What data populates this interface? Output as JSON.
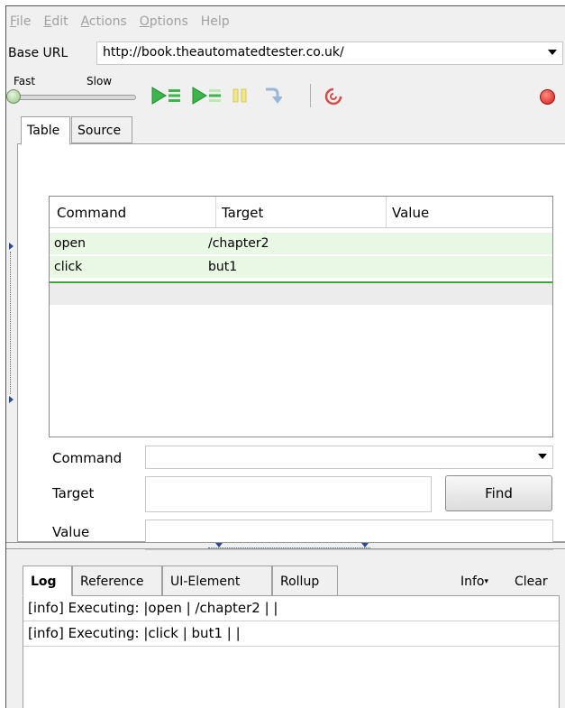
{
  "menu": {
    "items": [
      {
        "label": "File",
        "accel": "F",
        "rest": "ile"
      },
      {
        "label": "Edit",
        "accel": "E",
        "rest": "dit"
      },
      {
        "label": "Actions",
        "accel": "A",
        "rest": "ctions"
      },
      {
        "label": "Options",
        "accel": "O",
        "rest": "ptions"
      },
      {
        "label": "Help",
        "accel": "",
        "rest": "Help"
      }
    ]
  },
  "base_url": {
    "label": "Base URL",
    "value": "http://book.theautomatedtester.co.uk/"
  },
  "toolbar": {
    "speed_fast": "Fast",
    "speed_slow": "Slow",
    "speed_level": 0,
    "icons": [
      "play-all-icon",
      "play-current-icon",
      "pause-icon",
      "step-icon",
      "rollup-icon",
      "record-icon"
    ],
    "colors": {
      "play": "#3cb54a",
      "pause": "#e8d86a",
      "record": "#d81b1b",
      "rollup": "#d84a4a"
    }
  },
  "editor": {
    "tabs": {
      "table": "Table",
      "source": "Source"
    },
    "table": {
      "headers": {
        "command": "Command",
        "target": "Target",
        "value": "Value"
      },
      "rows": [
        {
          "command": "open",
          "target": "/chapter2",
          "value": ""
        },
        {
          "command": "click",
          "target": "but1",
          "value": ""
        }
      ]
    },
    "form": {
      "command_label": "Command",
      "command_value": "",
      "target_label": "Target",
      "target_value": "",
      "find_label": "Find",
      "value_label": "Value",
      "value_value": ""
    }
  },
  "log": {
    "tabs": {
      "log": "Log",
      "reference": "Reference",
      "ui_element": "UI-Element",
      "rollup": "Rollup"
    },
    "info_label": "Info",
    "clear_label": "Clear",
    "lines": [
      "[info] Executing: |open | /chapter2 | |",
      "[info] Executing: |click | but1 | |"
    ]
  }
}
